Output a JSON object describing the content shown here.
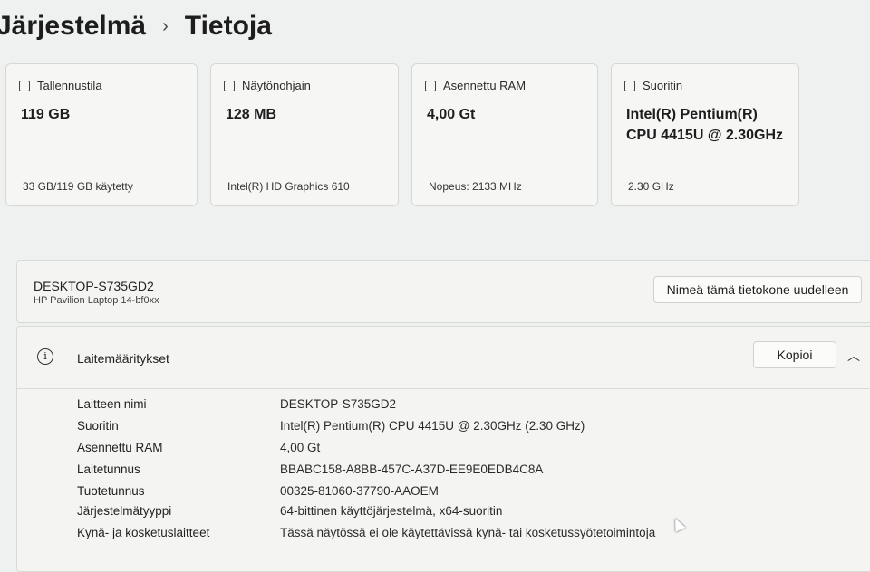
{
  "breadcrumb": {
    "parent": "Järjestelmä",
    "separator": "›",
    "current": "Tietoja"
  },
  "cards": [
    {
      "icon": "storage-icon",
      "title": "Tallennustila",
      "value": "119 GB",
      "sub": "33 GB/119 GB käytetty"
    },
    {
      "icon": "gpu-icon",
      "title": "Näytönohjain",
      "value": "128 MB",
      "sub": "Intel(R) HD Graphics 610"
    },
    {
      "icon": "ram-icon",
      "title": "Asennettu RAM",
      "value": "4,00 Gt",
      "sub": "Nopeus: 2133 MHz"
    },
    {
      "icon": "processor-icon",
      "title": "Suoritin",
      "value": "Intel(R) Pentium(R) CPU 4415U @ 2.30GHz",
      "sub": "2.30 GHz"
    }
  ],
  "device": {
    "name": "DESKTOP-S735GD2",
    "model": "HP Pavilion Laptop 14-bf0xx",
    "rename_button": "Nimeä tämä tietokone uudelleen"
  },
  "specs": {
    "title": "Laitemääritykset",
    "copy_button": "Kopioi",
    "collapse_icon": "chevron-up-icon",
    "rows": [
      {
        "key": "Laitteen nimi",
        "value": "DESKTOP-S735GD2"
      },
      {
        "key": "Suoritin",
        "value": "Intel(R) Pentium(R) CPU 4415U @ 2.30GHz (2.30 GHz)"
      },
      {
        "key": "Asennettu RAM",
        "value": "4,00 Gt"
      },
      {
        "key": "Laitetunnus",
        "value": "BBABC158-A8BB-457C-A37D-EE9E0EDB4C8A"
      },
      {
        "key": "Tuotetunnus",
        "value": "00325-81060-37790-AAOEM"
      },
      {
        "key": "Järjestelmätyyppi",
        "value": "64-bittinen käyttöjärjestelmä, x64-suoritin"
      },
      {
        "key": "Kynä- ja kosketuslaitteet",
        "value": "Tässä näytössä ei ole käytettävissä kynä- tai kosketussyötetoimintoja"
      }
    ]
  }
}
